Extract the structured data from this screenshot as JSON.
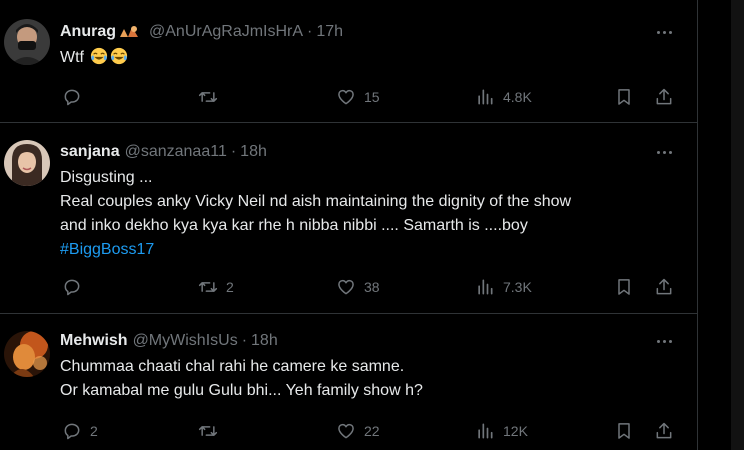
{
  "tweets": [
    {
      "name": "Anurag",
      "handle": "@AnUrAgRaJmIsHrA",
      "time": "17h",
      "body_line1": "Wtf",
      "replies": "",
      "retweets": "",
      "likes": "15",
      "views": "4.8K"
    },
    {
      "name": "sanjana",
      "handle": "@sanzanaa11",
      "time": "18h",
      "body_line1": "Disgusting ...",
      "body_line2": "Real couples anky Vicky Neil nd aish maintaining the dignity of the show",
      "body_line3": "and inko dekho kya kya kar rhe h nibba nibbi .... Samarth is ....boy",
      "hashtag": "#BiggBoss17",
      "replies": "",
      "retweets": "2",
      "likes": "38",
      "views": "7.3K"
    },
    {
      "name": "Mehwish",
      "handle": "@MyWishIsUs",
      "time": "18h",
      "body_line1": "Chummaa chaati chal rahi he camere ke samne.",
      "body_line2": "Or kamabal me gulu Gulu bhi... Yeh family show h?",
      "replies": "2",
      "retweets": "",
      "likes": "22",
      "views": "12K"
    }
  ],
  "separator": "·",
  "colors": {
    "background": "#000000",
    "text": "#e7e9ea",
    "secondary": "#71767b",
    "link": "#1d9bf0",
    "border": "#2f3336"
  },
  "icons": [
    "reply-icon",
    "retweet-icon",
    "like-icon",
    "views-icon",
    "bookmark-icon",
    "share-icon",
    "more-icon"
  ]
}
